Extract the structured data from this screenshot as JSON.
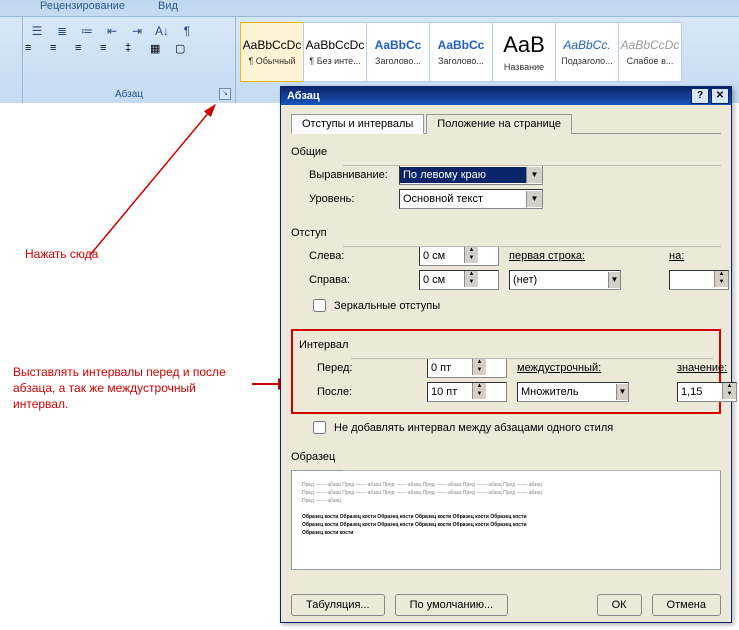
{
  "ribbon": {
    "tabs": [
      "Рецензирование",
      "Вид"
    ],
    "paragraphGroup": "Абзац",
    "styles": [
      {
        "preview": "AaBbCcDc",
        "label": "¶ Обычный",
        "selected": true,
        "previewColor": "#000"
      },
      {
        "preview": "AaBbCcDc",
        "label": "¶ Без инте...",
        "previewColor": "#000"
      },
      {
        "preview": "AaBbCc",
        "label": "Заголово...",
        "previewColor": "#1f5fbf",
        "bold": true
      },
      {
        "preview": "AaBbCc",
        "label": "Заголово...",
        "previewColor": "#1f5fbf",
        "bold": true
      },
      {
        "preview": "AaB",
        "label": "Название",
        "previewColor": "#000",
        "big": true
      },
      {
        "preview": "AaBbCc.",
        "label": "Подзаголо...",
        "previewColor": "#1f5fbf",
        "italic": true
      },
      {
        "preview": "AaBbCcDc",
        "label": "Слабое в...",
        "previewColor": "#999",
        "italic": true
      }
    ]
  },
  "annotations": {
    "click_here": "Нажать сюда",
    "interval_note": "Выставлять интервалы перед и после абзаца, а так же междустрочный интервал."
  },
  "dialog": {
    "title": "Абзац",
    "tabs": [
      "Отступы и интервалы",
      "Положение на странице"
    ],
    "sections": {
      "general": "Общие",
      "alignment_label": "Выравнивание:",
      "alignment_value": "По левому краю",
      "level_label": "Уровень:",
      "level_value": "Основной текст",
      "indent": "Отступ",
      "left_label": "Слева:",
      "left_value": "0 см",
      "right_label": "Справа:",
      "right_value": "0 см",
      "first_line_label": "первая строка:",
      "first_line_value": "(нет)",
      "by_label": "на:",
      "by_value": "",
      "mirror": "Зеркальные отступы",
      "interval": "Интервал",
      "before_label": "Перед:",
      "before_value": "0 пт",
      "after_label": "После:",
      "after_value": "10 пт",
      "line_spacing_label": "междустрочный:",
      "line_spacing_value": "Множитель",
      "spacing_by_label": "значение:",
      "spacing_by_value": "1,15",
      "no_space": "Не добавлять интервал между абзацами одного стиля",
      "preview": "Образец"
    },
    "buttons": {
      "tabs": "Табуляция...",
      "default": "По умолчанию...",
      "ok": "ОК",
      "cancel": "Отмена"
    }
  }
}
